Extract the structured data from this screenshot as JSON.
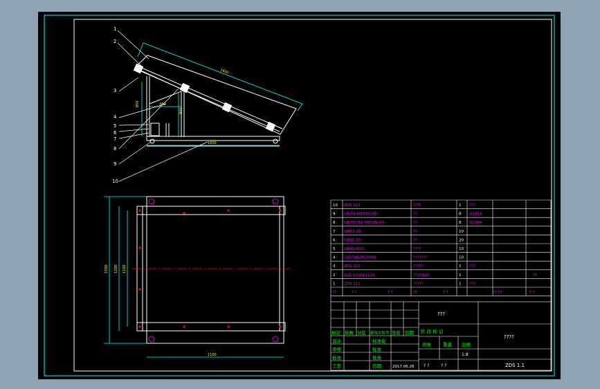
{
  "colors": {
    "background": "#8fa3b3",
    "paper": "#000000",
    "frame": "#00ffff",
    "line": "#ffffff",
    "dim": "#00ffff",
    "table_text": "#ff00ff",
    "title_text": "#00ff00",
    "center_line": "#ff0000",
    "hole": "#ff00ff",
    "bolt": "#ff0000"
  },
  "side_view": {
    "callouts": [
      "1",
      "2",
      "3",
      "4",
      "5",
      "6",
      "7",
      "8",
      "9",
      "10"
    ],
    "dims": {
      "panel_length": "1600",
      "top_width": "380",
      "height_left": "850",
      "height_mid": "800",
      "base_length": "1600"
    }
  },
  "top_view": {
    "dims": {
      "outer_width": "1500",
      "inner_width": "1200",
      "mid_width": "1100",
      "bottom_length": "1100"
    }
  },
  "parts_table": {
    "rows": [
      {
        "no": "10",
        "code": "ZDS 113",
        "name": "????",
        "qty": "1",
        "material": "???",
        "remark": ""
      },
      {
        "no": "9",
        "code": "GB/T6-M8X30(X5)",
        "name": "??",
        "qty": "8",
        "material": "Q235A",
        "remark": ""
      },
      {
        "no": "8",
        "code": "GB/T5783-M8X25(X5)",
        "name": "??",
        "qty": "8",
        "material": "Q235A",
        "remark": ""
      },
      {
        "no": "7",
        "code": "GB93-20",
        "name": "??",
        "qty": "10",
        "material": "",
        "remark": ""
      },
      {
        "no": "6",
        "code": "GB95-20",
        "name": "??",
        "qty": "20",
        "material": "",
        "remark": ""
      },
      {
        "no": "5",
        "code": "GB41-M20",
        "name": "????",
        "qty": "10",
        "material": "",
        "remark": ""
      },
      {
        "no": "4",
        "code": "GB5780-M20X80",
        "name": "???????",
        "qty": "10",
        "material": "",
        "remark": ""
      },
      {
        "no": "3",
        "code": "ZDS 112",
        "name": "?????",
        "qty": "1",
        "material": "???",
        "remark": ""
      },
      {
        "no": "2",
        "code": "GLS-1020X1120",
        "name": "??20X20",
        "qty": "1",
        "material": "",
        "remark": "??"
      },
      {
        "no": "1",
        "code": "ZDS 111",
        "name": "?????",
        "qty": "1",
        "material": "???",
        "remark": ""
      }
    ],
    "header": [
      "??",
      "? ?",
      "? ?",
      "??",
      "? ?",
      "??  ??",
      "? ?"
    ]
  },
  "title_block": {
    "title": "???",
    "drawing_name": "????",
    "drawing_no": "ZDS 1.1",
    "scale": "1:8",
    "date": "2017.06.26",
    "revision_header": [
      "标记",
      "处数",
      "分区",
      "更改文件号",
      "签名",
      "日期"
    ],
    "roles": [
      "设计",
      "审核",
      "批准",
      "工艺"
    ],
    "role_values": [
      "标准化",
      "批准",
      "批准",
      "日期"
    ],
    "stage_header": [
      "阶 段 标 记",
      "重量",
      "比例"
    ],
    "stage_sub": [
      "共张",
      "第张"
    ],
    "footer": [
      "? ?",
      "? ?"
    ]
  }
}
